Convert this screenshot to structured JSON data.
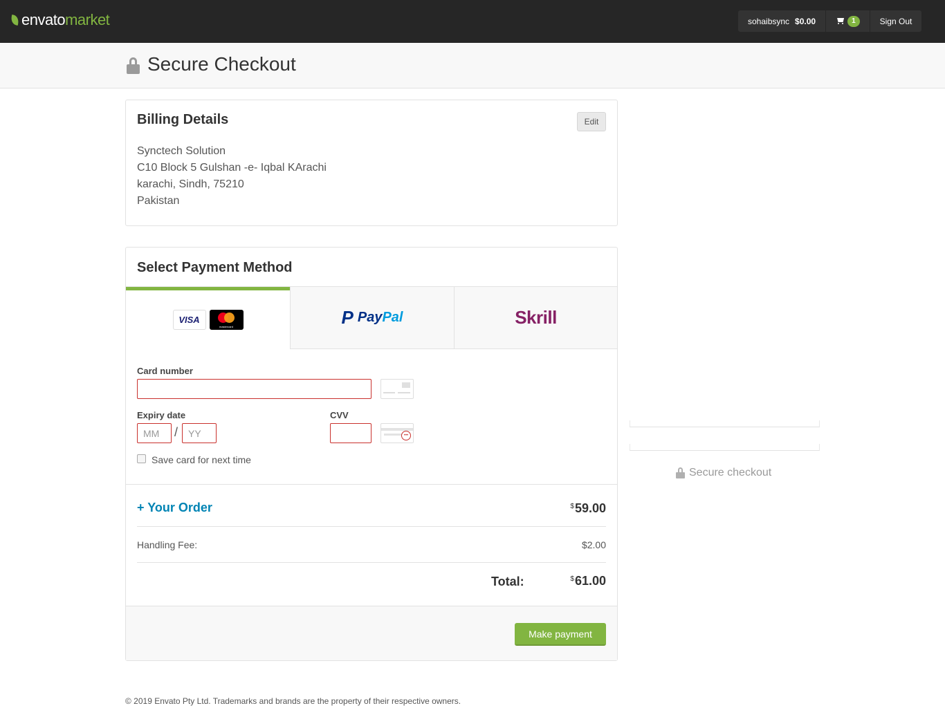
{
  "topbar": {
    "logo_part1": "envato",
    "logo_part2": "market",
    "username": "sohaibsync",
    "balance": "$0.00",
    "cart_count": "1",
    "sign_out": "Sign Out"
  },
  "header": {
    "title": "Secure Checkout"
  },
  "billing": {
    "title": "Billing Details",
    "edit_label": "Edit",
    "address": [
      "Synctech Solution",
      "C10 Block 5 Gulshan -e- Iqbal KArachi",
      "karachi, Sindh, 75210",
      "Pakistan"
    ]
  },
  "payment": {
    "title": "Select Payment Method",
    "tabs": [
      {
        "label": "Card",
        "icons": [
          "visa-icon",
          "mastercard-icon"
        ],
        "active": true
      },
      {
        "label": "PayPal",
        "icons": [
          "paypal-icon"
        ],
        "active": false
      },
      {
        "label": "Skrill",
        "icons": [
          "skrill-icon"
        ],
        "active": false
      }
    ],
    "visa_text": "VISA",
    "mastercard_text": "mastercard",
    "paypal_mark": "P",
    "paypal_text1": "Pay",
    "paypal_text2": "Pal",
    "skrill_text": "Skrill",
    "card_number_label": "Card number",
    "card_number_value": "",
    "expiry_label": "Expiry date",
    "expiry_mm_placeholder": "MM",
    "expiry_yy_placeholder": "YY",
    "expiry_separator": "/",
    "cvv_label": "CVV",
    "cvv_value": "",
    "save_card_label": "Save card for next time",
    "save_card_checked": false
  },
  "order": {
    "toggle_label": "+ Your Order",
    "subtotal_currency": "$",
    "subtotal": "59.00",
    "handling_label": "Handling Fee:",
    "handling_value": "$2.00",
    "total_label": "Total:",
    "total_currency": "$",
    "total": "61.00",
    "pay_button": "Make payment"
  },
  "sidebar": {
    "secure_label": "Secure checkout"
  },
  "footer": {
    "copyright": "© 2019 Envato Pty Ltd. Trademarks and brands are the property of their respective owners."
  },
  "colors": {
    "accent": "#82b541",
    "link": "#0084b4",
    "error_border": "#c9302c",
    "topbar": "#262626"
  }
}
